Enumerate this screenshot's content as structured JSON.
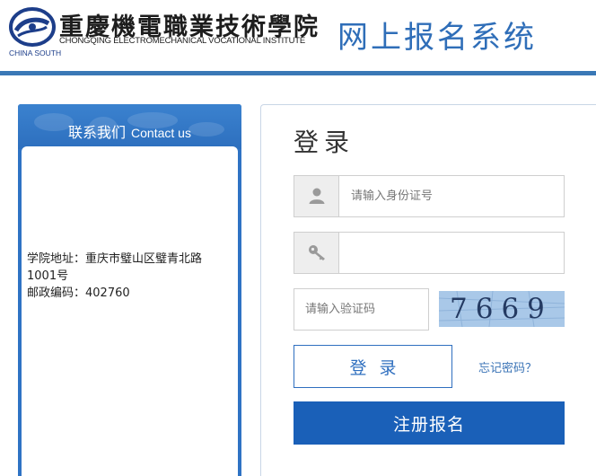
{
  "header": {
    "school_name_cn": "重慶機電職業技術學院",
    "school_name_en": "CHONGQING ELECTROMECHANICAL VOCATIONAL INSTITUTE",
    "logo_subtitle": "CHINA SOUTH",
    "system_title": "网上报名系统",
    "brand_color": "#3a78b6"
  },
  "contact": {
    "title_cn": "联系我们",
    "title_en": "Contact us",
    "address_line1": "学院地址：重庆市璧山区璧青北路",
    "address_line2": "1001号",
    "postcode": "邮政编码：402760"
  },
  "login": {
    "title": "登录",
    "id_placeholder": "请输入身份证号",
    "password_value": "",
    "captcha_placeholder": "请输入验证码",
    "captcha_code": "7669",
    "login_label": "登录",
    "forgot_label": "忘记密码？",
    "register_label": "注册报名",
    "icons": {
      "user": "user-icon",
      "password": "key-icon"
    }
  }
}
